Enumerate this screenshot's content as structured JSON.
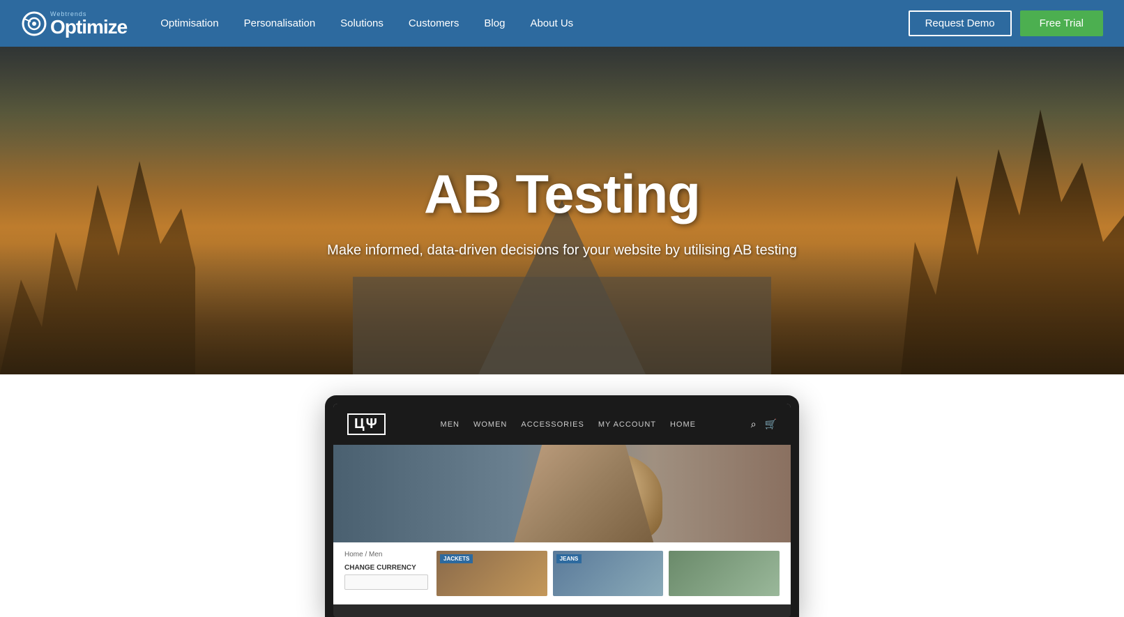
{
  "navbar": {
    "logo": {
      "webtrends_label": "Webtrends",
      "optimize_label": "Optimize"
    },
    "nav_items": [
      {
        "label": "Optimisation",
        "href": "#"
      },
      {
        "label": "Personalisation",
        "href": "#"
      },
      {
        "label": "Solutions",
        "href": "#"
      },
      {
        "label": "Customers",
        "href": "#"
      },
      {
        "label": "Blog",
        "href": "#"
      },
      {
        "label": "About Us",
        "href": "#"
      }
    ],
    "request_demo_label": "Request Demo",
    "free_trial_label": "Free Trial"
  },
  "hero": {
    "title": "AB Testing",
    "subtitle": "Make informed, data-driven decisions for your website by utilising AB testing"
  },
  "mocksite": {
    "logo": "ЦΨ",
    "nav": [
      "MEN",
      "WOMEN",
      "ACCESSORIES",
      "MY ACCOUNT",
      "HOME"
    ],
    "breadcrumb": "Home / Men",
    "filter_label": "CHANGE CURRENCY",
    "products": [
      {
        "label": "JACKETS"
      },
      {
        "label": "JEANS"
      },
      {
        "label": ""
      }
    ]
  },
  "colors": {
    "navbar_bg": "#2d6a9f",
    "free_trial_bg": "#4caf50",
    "accent": "#2d6a9f"
  }
}
